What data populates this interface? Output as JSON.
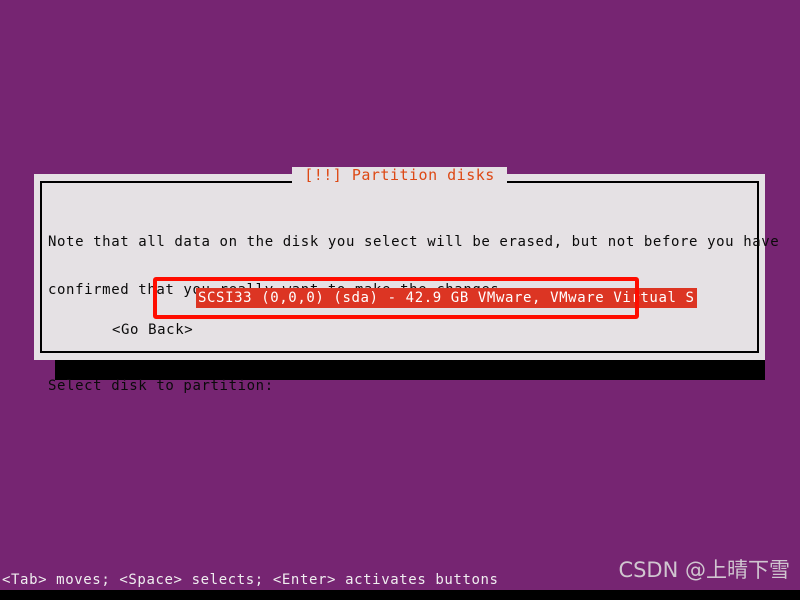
{
  "screen": {
    "background_color": "#762572",
    "accent_color": "#dd4814",
    "highlight_color": "#dc3523",
    "annotation_color": "#ff0d00",
    "panel_color": "#e5e1e4"
  },
  "dialog": {
    "title": "[!!] Partition disks",
    "note_line_1": "Note that all data on the disk you select will be erased, but not before you have",
    "note_line_2": "confirmed that you really want to make the changes.",
    "prompt": "Select disk to partition:",
    "disk_options": [
      "SCSI33 (0,0,0) (sda) - 42.9 GB VMware, VMware Virtual S"
    ],
    "selected_disk_index": 0,
    "go_back_label": "<Go Back>"
  },
  "footer": {
    "hint": "<Tab> moves; <Space> selects; <Enter> activates buttons"
  },
  "watermark": {
    "text": "CSDN @上晴下雪"
  }
}
